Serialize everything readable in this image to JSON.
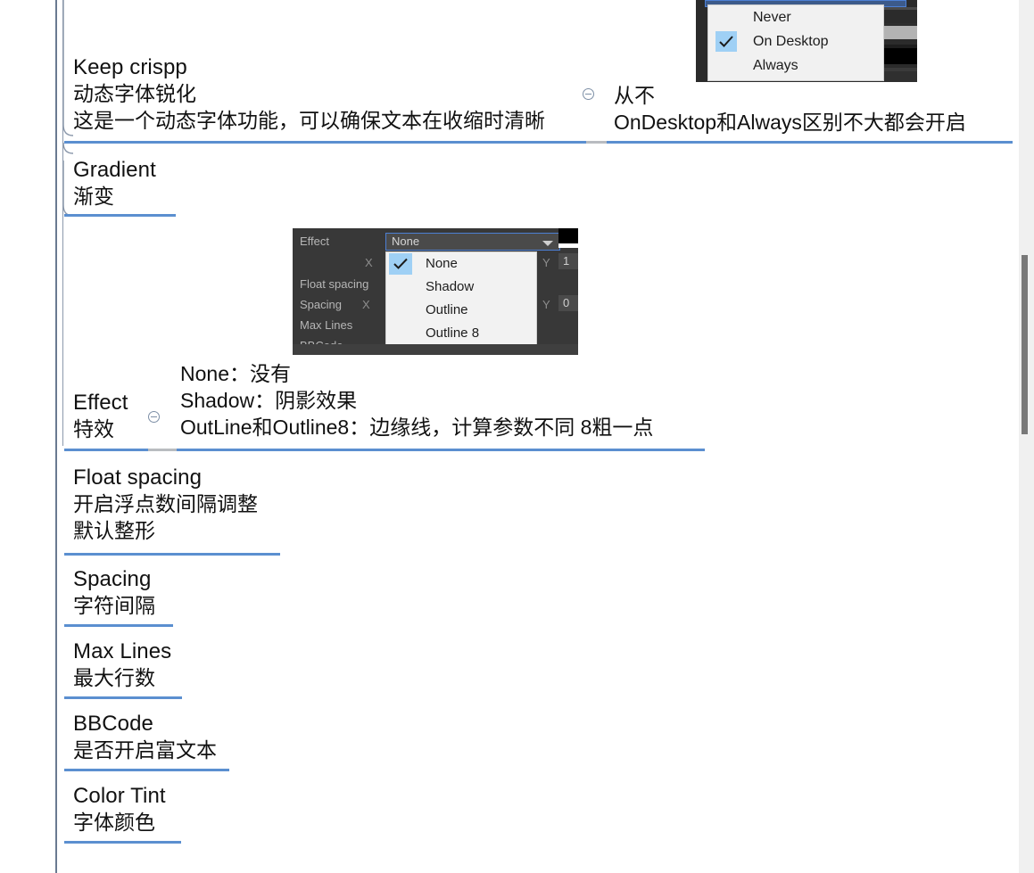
{
  "document": {
    "type": "mindmap-notes",
    "theme_line_color": "#5b8fd0",
    "spine_color": "#6a7a90"
  },
  "topics": [
    {
      "id": "keep-crispp",
      "title_en": "Keep crispp",
      "title_cn": "动态字体锐化",
      "note_cn": "这是一个动态字体功能，可以确保文本在收缩时清晰"
    },
    {
      "id": "keep-crispp-detail",
      "title_cn": "从不",
      "note_cn": "OnDesktop和Always区别不大都会开启"
    },
    {
      "id": "gradient",
      "title_en": "Gradient",
      "title_cn": "渐变"
    },
    {
      "id": "effect",
      "title_en": "Effect",
      "title_cn": "特效",
      "detail_lines": [
        "None：没有",
        "Shadow：阴影效果",
        "OutLine和Outline8：边缘线，计算参数不同 8粗一点"
      ]
    },
    {
      "id": "float-spacing",
      "title_en": "Float spacing",
      "title_cn": "开启浮点数间隔调整",
      "note_cn": "默认整形"
    },
    {
      "id": "spacing",
      "title_en": "Spacing",
      "title_cn": "字符间隔"
    },
    {
      "id": "max-lines",
      "title_en": "Max Lines",
      "title_cn": "最大行数"
    },
    {
      "id": "bbcode",
      "title_en": "BBCode",
      "title_cn": "是否开启富文本"
    },
    {
      "id": "color-tint",
      "title_en": "Color Tint",
      "title_cn": "字体颜色"
    }
  ],
  "screenshot_desktop_dropdown": {
    "options": [
      {
        "label": "Never",
        "checked": false
      },
      {
        "label": "On Desktop",
        "checked": true
      },
      {
        "label": "Always",
        "checked": false
      }
    ]
  },
  "screenshot_effect_inspector": {
    "labels": {
      "effect": "Effect",
      "x_top": "X",
      "float_spacing": "Float spacing",
      "spacing": "Spacing",
      "spacing_x": "X",
      "max_lines": "Max Lines",
      "bbcode": "BBCode",
      "y_top": "Y",
      "y_mid": "Y"
    },
    "combo_value": "None",
    "fields": {
      "y_top_value": "1",
      "y_mid_value": "0"
    },
    "options": [
      {
        "label": "None",
        "checked": true
      },
      {
        "label": "Shadow",
        "checked": false
      },
      {
        "label": "Outline",
        "checked": false
      },
      {
        "label": "Outline 8",
        "checked": false
      }
    ]
  }
}
